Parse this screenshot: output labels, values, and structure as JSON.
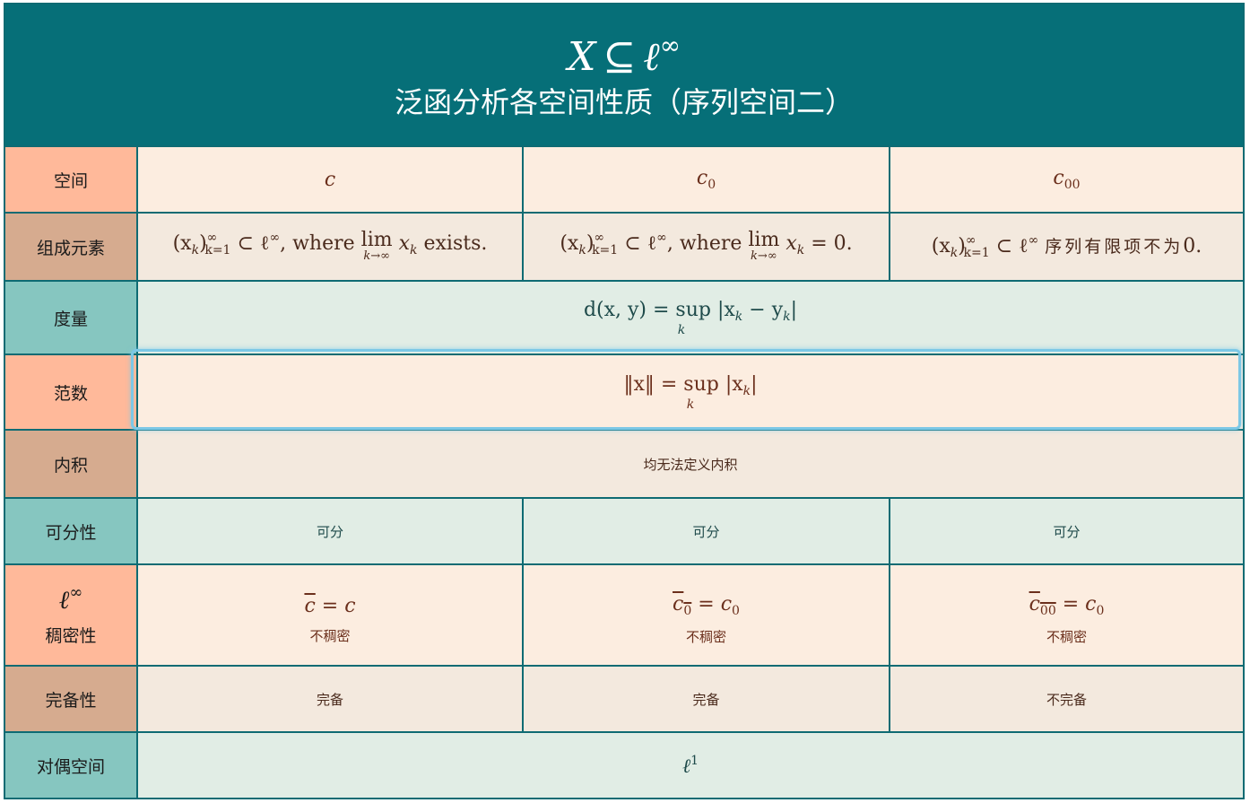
{
  "header": {
    "formula_lhs": "X",
    "formula_op": "⊆",
    "formula_rhs": "ℓ",
    "formula_rhs_sup": "∞",
    "title": "泛函分析各空间性质（序列空间二）"
  },
  "rows": {
    "space": {
      "label": "空间",
      "c1": "c",
      "c2": "c",
      "c2_sub": "0",
      "c3": "c",
      "c3_sub": "00"
    },
    "elements": {
      "label": "组成元素",
      "c1_prefix": "(x",
      "c1_text": "⊂ ℓ",
      "c1_where": ", where",
      "c1_lim": "lim",
      "c1_lim_under": "k→∞",
      "c1_tail": "x",
      "c1_end": "exists.",
      "c2_end": "= 0.",
      "c3_text": "序列有限项不为",
      "c3_end": "0."
    },
    "metric": {
      "label": "度量",
      "formula": "d(x, y) = sup |x",
      "sup_under": "k",
      "tail": " − y",
      "close": "|"
    },
    "norm": {
      "label": "范数",
      "formula": "‖x‖ = sup |x",
      "sup_under": "k",
      "close": "|"
    },
    "inner": {
      "label": "内积",
      "text": "均无法定义内积"
    },
    "separable": {
      "label": "可分性",
      "c1": "可分",
      "c2": "可分",
      "c3": "可分"
    },
    "dense": {
      "label_math": "ℓ",
      "label_sup": "∞",
      "label": "稠密性",
      "c1_math": "c",
      "c1_eq": "= c",
      "c1_note": "不稠密",
      "c2_math": "c",
      "c2_eq": "= c",
      "c2_note": "不稠密",
      "c3_math": "c",
      "c3_eq": "= c",
      "c3_note": "不稠密"
    },
    "complete": {
      "label": "完备性",
      "c1": "完备",
      "c2": "完备",
      "c3": "不完备"
    },
    "dual": {
      "label": "对偶空间",
      "math": "ℓ",
      "sup": "1"
    }
  },
  "colors": {
    "header_bg": "#066f78",
    "border": "#0e6b73",
    "peach": "#fcede0",
    "tan": "#f3e9de",
    "mint": "#e1ede5",
    "highlight": "#7cc8e6"
  }
}
